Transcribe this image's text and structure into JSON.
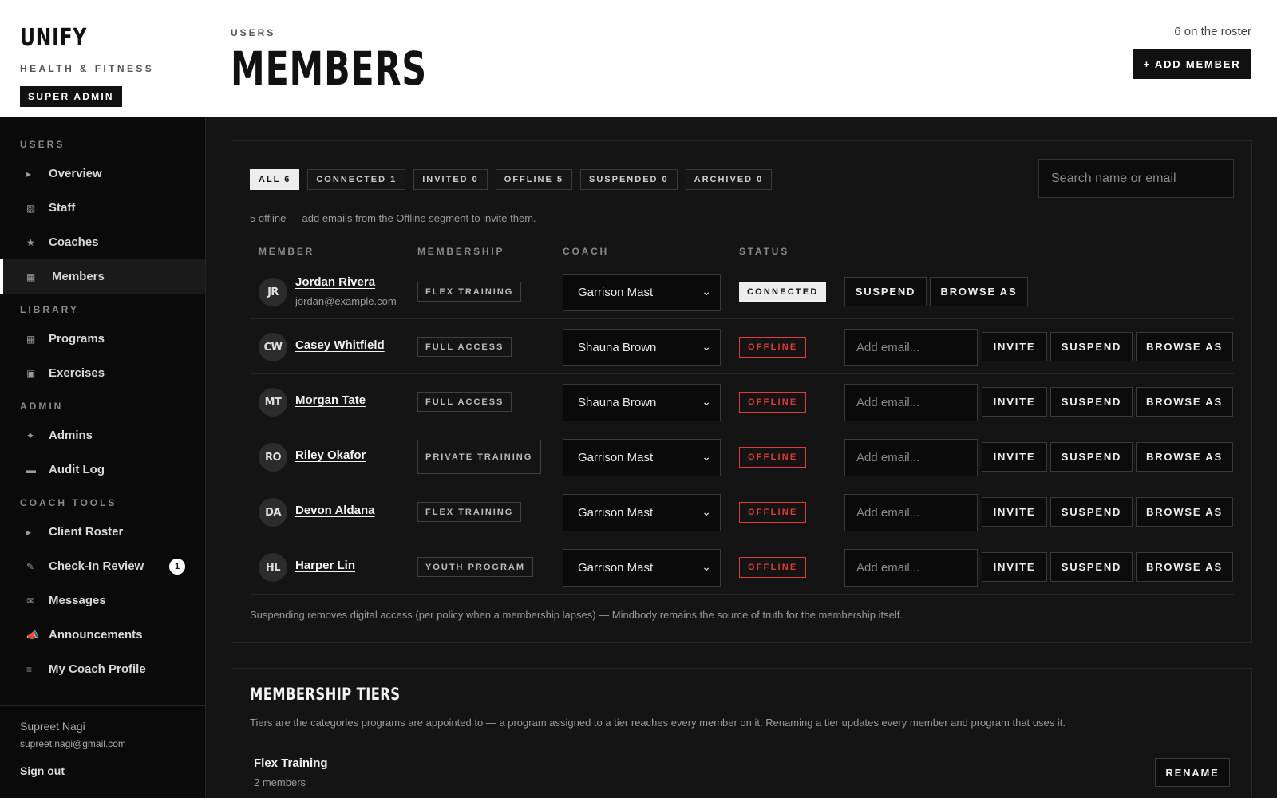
{
  "brand": {
    "name": "UNIFY",
    "tagline": "HEALTH & FITNESS",
    "role": "SUPER ADMIN"
  },
  "header": {
    "breadcrumb": "USERS",
    "title": "MEMBERS",
    "roster_count": "6 on the roster",
    "add_button": "+ ADD MEMBER"
  },
  "sidebar": {
    "sections": [
      {
        "label": "USERS",
        "items": [
          {
            "label": "Overview",
            "icon": "caret-right-icon",
            "glyph": "▸"
          },
          {
            "label": "Staff",
            "icon": "grid-icon",
            "glyph": "▨"
          },
          {
            "label": "Coaches",
            "icon": "star-icon",
            "glyph": "★"
          },
          {
            "label": "Members",
            "icon": "square-icon",
            "glyph": "▦",
            "active": true
          }
        ]
      },
      {
        "label": "LIBRARY",
        "items": [
          {
            "label": "Programs",
            "icon": "square-icon",
            "glyph": "▦"
          },
          {
            "label": "Exercises",
            "icon": "square-outline-icon",
            "glyph": "▣"
          }
        ]
      },
      {
        "label": "ADMIN",
        "items": [
          {
            "label": "Admins",
            "icon": "sparkle-icon",
            "glyph": "✦"
          },
          {
            "label": "Audit Log",
            "icon": "small-square-icon",
            "glyph": "▬"
          }
        ]
      },
      {
        "label": "COACH TOOLS",
        "items": [
          {
            "label": "Client Roster",
            "icon": "caret-right-icon",
            "glyph": "▸"
          },
          {
            "label": "Check-In Review",
            "icon": "pencil-icon",
            "glyph": "✎",
            "badge": "1"
          },
          {
            "label": "Messages",
            "icon": "envelope-icon",
            "glyph": "✉"
          },
          {
            "label": "Announcements",
            "icon": "megaphone-icon",
            "glyph": "📣"
          },
          {
            "label": "My Coach Profile",
            "icon": "menu-icon",
            "glyph": "≡"
          }
        ]
      }
    ],
    "user": {
      "name": "Supreet Nagi",
      "email": "supreet.nagi@gmail.com"
    },
    "sign_out": "Sign out"
  },
  "filters": [
    {
      "label": "ALL 6",
      "active": true
    },
    {
      "label": "CONNECTED 1"
    },
    {
      "label": "INVITED 0"
    },
    {
      "label": "OFFLINE 5"
    },
    {
      "label": "SUSPENDED 0"
    },
    {
      "label": "ARCHIVED 0"
    }
  ],
  "search": {
    "placeholder": "Search name or email"
  },
  "hint": "5 offline — add emails from the Offline segment to invite them.",
  "table": {
    "columns": [
      "MEMBER",
      "MEMBERSHIP",
      "COACH",
      "STATUS"
    ],
    "email_placeholder": "Add email...",
    "buttons": {
      "invite": "INVITE",
      "suspend": "SUSPEND",
      "browse": "BROWSE AS"
    },
    "rows": [
      {
        "initials": "JR",
        "name": "Jordan Rivera",
        "email": "jordan@example.com",
        "tier": "FLEX TRAINING",
        "coach": "Garrison Mast",
        "status": "CONNECTED"
      },
      {
        "initials": "CW",
        "name": "Casey Whitfield",
        "email": "",
        "tier": "FULL ACCESS",
        "coach": "Shauna Brown",
        "status": "OFFLINE"
      },
      {
        "initials": "MT",
        "name": "Morgan Tate",
        "email": "",
        "tier": "FULL ACCESS",
        "coach": "Shauna Brown",
        "status": "OFFLINE"
      },
      {
        "initials": "RO",
        "name": "Riley Okafor",
        "email": "",
        "tier": "PRIVATE TRAINING",
        "coach": "Garrison Mast",
        "status": "OFFLINE"
      },
      {
        "initials": "DA",
        "name": "Devon Aldana",
        "email": "",
        "tier": "FLEX TRAINING",
        "coach": "Garrison Mast",
        "status": "OFFLINE"
      },
      {
        "initials": "HL",
        "name": "Harper Lin",
        "email": "",
        "tier": "YOUTH PROGRAM",
        "coach": "Garrison Mast",
        "status": "OFFLINE"
      }
    ]
  },
  "footnote": "Suspending removes digital access (per policy when a membership lapses) — Mindbody remains the source of truth for the membership itself.",
  "tiers": {
    "title": "MEMBERSHIP TIERS",
    "description": "Tiers are the categories programs are appointed to — a program assigned to a tier reaches every member on it. Renaming a tier updates every member and program that uses it.",
    "items": [
      {
        "name": "Flex Training",
        "count": "2 members",
        "action": "RENAME"
      }
    ]
  },
  "colors": {
    "offline": "#e03a3a",
    "accent": "#ffffff",
    "background": "#141414"
  }
}
